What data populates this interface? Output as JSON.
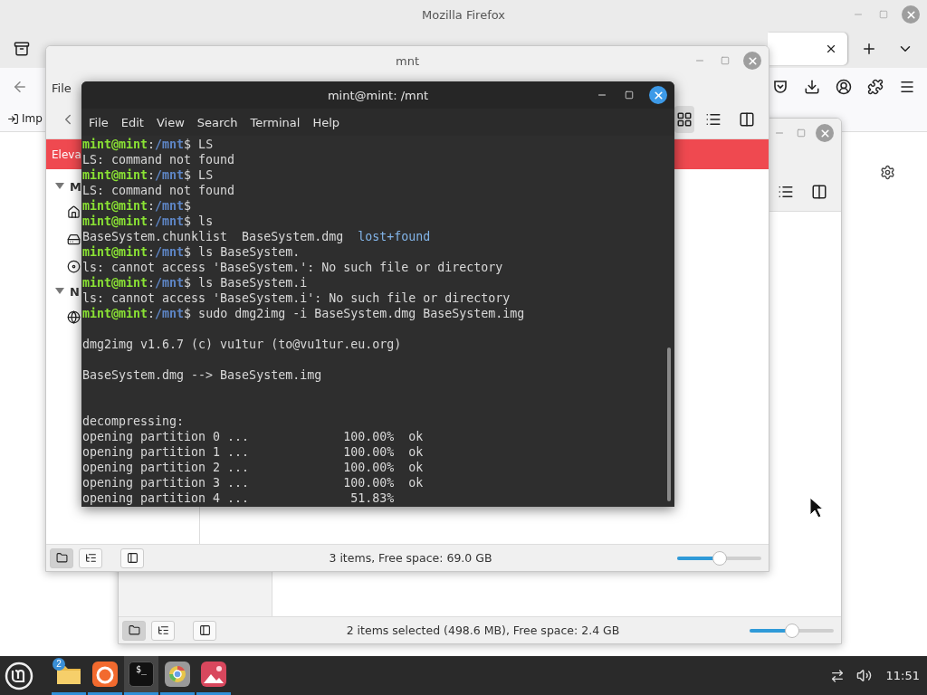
{
  "firefox": {
    "title": "Mozilla Firefox",
    "bookmark": "Imp"
  },
  "file_manager_back": {
    "views": [
      {
        "kind": "list",
        "selected": false
      },
      {
        "kind": "compact",
        "selected": false
      }
    ],
    "status_buttons": [
      {
        "kind": "places",
        "selected": true
      },
      {
        "kind": "tree",
        "selected": false
      },
      {
        "kind": "sidebar",
        "selected": false
      }
    ],
    "status": "2 items selected (498.6 MB), Free space: 2.4 GB",
    "zoom": {
      "level": 0.5
    }
  },
  "file_manager_front": {
    "title": "mnt",
    "menu": [
      "File"
    ],
    "banner": "Eleva",
    "sidebar_sections": [
      {
        "heading": "M",
        "expanded": true,
        "items": [
          {
            "kind": "home"
          },
          {
            "kind": "drive"
          },
          {
            "kind": "disc"
          }
        ]
      },
      {
        "heading": "N",
        "expanded": true,
        "items": [
          {
            "kind": "network"
          }
        ]
      }
    ],
    "views": [
      {
        "kind": "icons",
        "selected": true
      },
      {
        "kind": "list",
        "selected": false
      },
      {
        "kind": "compact",
        "selected": false
      }
    ],
    "status_buttons": [
      {
        "kind": "places",
        "selected": true
      },
      {
        "kind": "tree",
        "selected": false
      },
      {
        "kind": "sidebar",
        "selected": false
      }
    ],
    "status": "3 items, Free space: 69.0 GB",
    "zoom": {
      "level": 0.5
    }
  },
  "terminal": {
    "title": "mint@mint: /mnt",
    "menu": [
      "File",
      "Edit",
      "View",
      "Search",
      "Terminal",
      "Help"
    ],
    "lines": [
      {
        "kind": "prompt",
        "user": "mint@mint",
        "sep": ":",
        "path": "/mnt",
        "command": "$ LS"
      },
      {
        "kind": "output",
        "text": "LS: command not found"
      },
      {
        "kind": "prompt",
        "user": "mint@mint",
        "sep": ":",
        "path": "/mnt",
        "command": "$ LS"
      },
      {
        "kind": "output",
        "text": "LS: command not found"
      },
      {
        "kind": "prompt",
        "user": "mint@mint",
        "sep": ":",
        "path": "/mnt",
        "command": "$"
      },
      {
        "kind": "prompt",
        "user": "mint@mint",
        "sep": ":",
        "path": "/mnt",
        "command": "$ ls"
      },
      {
        "kind": "listing",
        "text": "BaseSystem.chunklist  BaseSystem.dmg  ",
        "dir": "lost+found"
      },
      {
        "kind": "prompt",
        "user": "mint@mint",
        "sep": ":",
        "path": "/mnt",
        "command": "$ ls BaseSystem."
      },
      {
        "kind": "output",
        "text": "ls: cannot access 'BaseSystem.': No such file or directory"
      },
      {
        "kind": "prompt",
        "user": "mint@mint",
        "sep": ":",
        "path": "/mnt",
        "command": "$ ls BaseSystem.i"
      },
      {
        "kind": "output",
        "text": "ls: cannot access 'BaseSystem.i': No such file or directory"
      },
      {
        "kind": "prompt",
        "user": "mint@mint",
        "sep": ":",
        "path": "/mnt",
        "command": "$ sudo dmg2img -i BaseSystem.dmg BaseSystem.img"
      },
      {
        "kind": "blank"
      },
      {
        "kind": "output",
        "text": "dmg2img v1.6.7 (c) vu1tur (to@vu1tur.eu.org)"
      },
      {
        "kind": "blank"
      },
      {
        "kind": "output",
        "text": "BaseSystem.dmg --> BaseSystem.img"
      },
      {
        "kind": "blank"
      },
      {
        "kind": "blank"
      },
      {
        "kind": "output",
        "text": "decompressing:"
      },
      {
        "kind": "output",
        "text": "opening partition 0 ...             100.00%  ok"
      },
      {
        "kind": "output",
        "text": "opening partition 1 ...             100.00%  ok"
      },
      {
        "kind": "output",
        "text": "opening partition 2 ...             100.00%  ok"
      },
      {
        "kind": "output",
        "text": "opening partition 3 ...             100.00%  ok"
      },
      {
        "kind": "output",
        "text": "opening partition 4 ...              51.83%"
      }
    ]
  },
  "taskbar": {
    "apps": [
      {
        "kind": "files",
        "badge": "2",
        "selected": false,
        "running": true
      },
      {
        "kind": "firefox",
        "selected": false,
        "running": true
      },
      {
        "kind": "terminal",
        "glyph": "$_",
        "selected": true,
        "running": true
      },
      {
        "kind": "browser",
        "selected": false,
        "running": true
      },
      {
        "kind": "images",
        "selected": false,
        "running": true
      }
    ],
    "clock": "11:51"
  }
}
